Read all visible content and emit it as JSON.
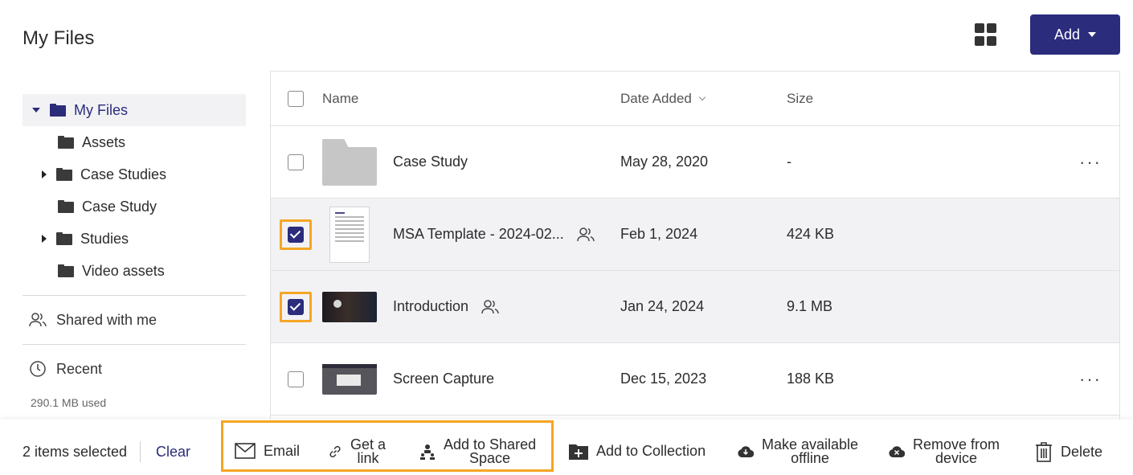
{
  "header": {
    "title": "My Files",
    "add_label": "Add"
  },
  "sidebar": {
    "root": "My Files",
    "folders": [
      "Assets",
      "Case Studies",
      "Case Study",
      "Studies",
      "Video assets"
    ],
    "shared": "Shared with me",
    "recent": "Recent",
    "usage": "290.1 MB used"
  },
  "table": {
    "columns": {
      "name": "Name",
      "date": "Date Added",
      "size": "Size"
    },
    "rows": [
      {
        "name": "Case Study",
        "date": "May 28, 2020",
        "size": "-",
        "selected": false,
        "type": "folder"
      },
      {
        "name": "MSA Template - 2024-02...",
        "date": "Feb 1, 2024",
        "size": "424 KB",
        "selected": true,
        "type": "document",
        "shared": true
      },
      {
        "name": "Introduction",
        "date": "Jan 24, 2024",
        "size": "9.1 MB",
        "selected": true,
        "type": "video",
        "shared": true
      },
      {
        "name": "Screen Capture",
        "date": "Dec 15, 2023",
        "size": "188 KB",
        "selected": false,
        "type": "video"
      }
    ],
    "more_label": "···"
  },
  "actions": {
    "count": "2 items selected",
    "clear": "Clear",
    "email": "Email",
    "get_link_1": "Get a",
    "get_link_2": "link",
    "shared_space_1": "Add to Shared",
    "shared_space_2": "Space",
    "collection": "Add to Collection",
    "offline_1": "Make available",
    "offline_2": "offline",
    "remove_1": "Remove from",
    "remove_2": "device",
    "delete": "Delete"
  },
  "colors": {
    "accent": "#2b2c7c",
    "highlight": "#f5a623",
    "selected_row": "#f2f2f5"
  }
}
